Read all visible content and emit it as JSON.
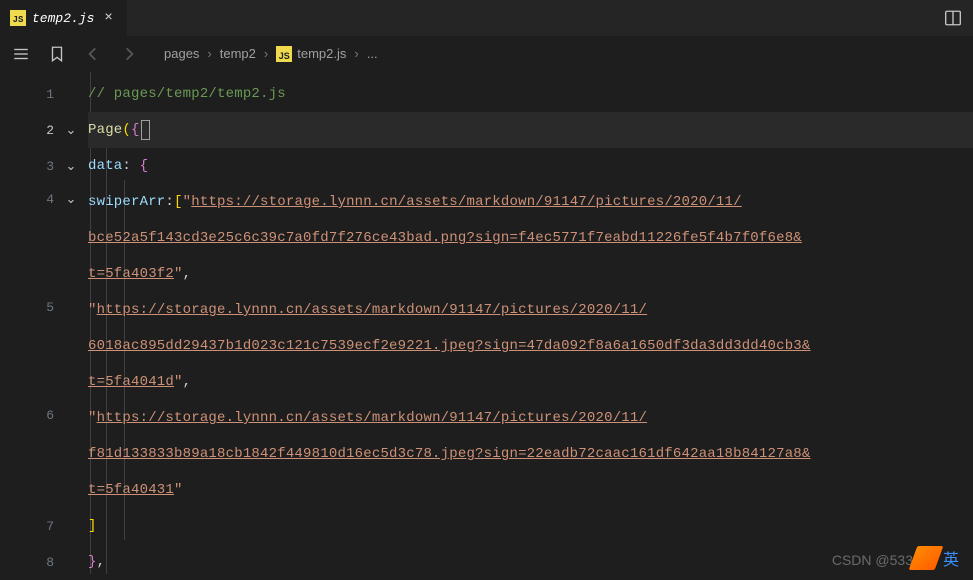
{
  "tab": {
    "label": "temp2.js"
  },
  "breadcrumb": {
    "b0": "pages",
    "b1": "temp2",
    "b2": "temp2.js",
    "b3": "..."
  },
  "gutter": {
    "l1": "1",
    "l2": "2",
    "l3": "3",
    "l4": "4",
    "l5": "5",
    "l6": "6",
    "l7": "7",
    "l8": "8"
  },
  "code": {
    "comment": "// pages/temp2/temp2.js",
    "page_fn": "Page",
    "data_prop": "data",
    "swiper_prop": "swiperArr",
    "str0a": "\"",
    "url0_a": "https://storage.lynnn.cn/assets/markdown/91147/pictures/2020/11/",
    "url0_b": "bce52a5f143cd3e25c6c39c7a0fd7f276ce43bad.png?sign=f4ec5771f7eabd11226fe5f4b7f0f6e8&",
    "url0_c": "t=5fa403f2",
    "url1_a": "https://storage.lynnn.cn/assets/markdown/91147/pictures/2020/11/",
    "url1_b": "6018ac895dd29437b1d023c121c7539ecf2e9221.jpeg?sign=47da092f8a6a1650df3da3dd3dd40cb3&",
    "url1_c": "t=5fa4041d",
    "url2_a": "https://storage.lynnn.cn/assets/markdown/91147/pictures/2020/11/",
    "url2_b": "f81d133833b89a18cb1842f449810d16ec5d3c78.jpeg?sign=22eadb72caac161df642aa18b84127a8&",
    "url2_c": "t=5fa40431",
    "close_brack": "]",
    "close_brace_comma": "},"
  },
  "watermark": "CSDN @533",
  "ime": "英"
}
